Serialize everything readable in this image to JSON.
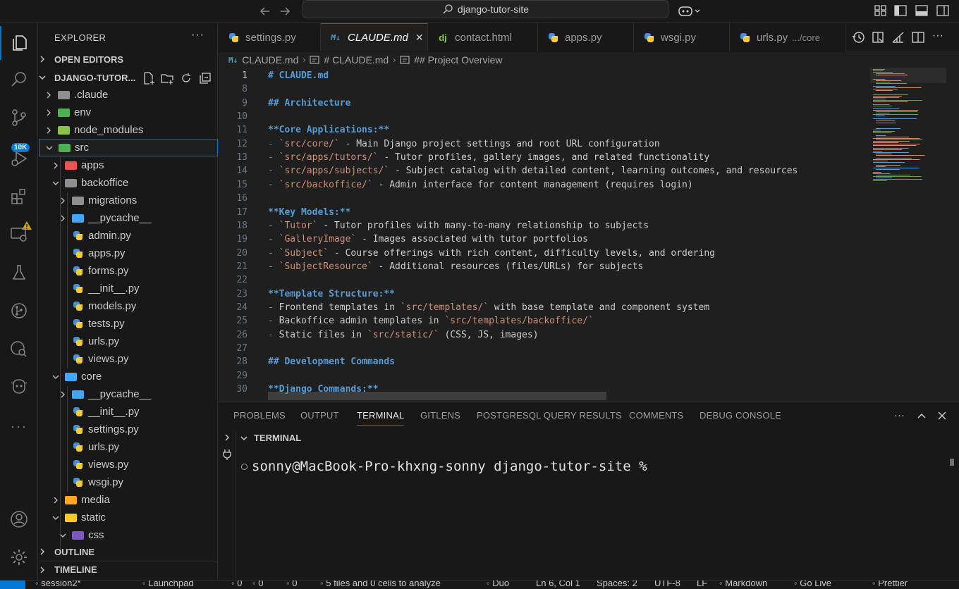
{
  "titlebar": {
    "search_text": "django-tutor-site",
    "back_icon": "arrow-left-icon",
    "forward_icon": "arrow-right-icon",
    "copilot_icon": "copilot-icon"
  },
  "activity": {
    "badge": "10K"
  },
  "sidebar": {
    "title": "EXPLORER",
    "more": "···",
    "open_editors": "OPEN EDITORS",
    "project": "DJANGO-TUTOR...",
    "outline": "OUTLINE",
    "timeline": "TIMELINE",
    "tree": [
      {
        "label": ".claude",
        "kind": "folder",
        "depth": 1,
        "open": false,
        "color": "#8f8f8f"
      },
      {
        "label": "env",
        "kind": "folder",
        "depth": 1,
        "open": false,
        "color": "#4caf50"
      },
      {
        "label": "node_modules",
        "kind": "folder",
        "depth": 1,
        "open": false,
        "color": "#8bc34a"
      },
      {
        "label": "src",
        "kind": "folder",
        "depth": 1,
        "open": true,
        "color": "#4caf50"
      },
      {
        "label": "apps",
        "kind": "folder",
        "depth": 2,
        "open": false,
        "color": "#ef5350"
      },
      {
        "label": "backoffice",
        "kind": "folder",
        "depth": 2,
        "open": true,
        "color": "#8f8f8f"
      },
      {
        "label": "migrations",
        "kind": "folder",
        "depth": 3,
        "open": false,
        "color": "#8f8f8f"
      },
      {
        "label": "__pycache__",
        "kind": "folder",
        "depth": 3,
        "open": false,
        "color": "#42a5f5"
      },
      {
        "label": "admin.py",
        "kind": "py",
        "depth": 3
      },
      {
        "label": "apps.py",
        "kind": "py",
        "depth": 3
      },
      {
        "label": "forms.py",
        "kind": "py",
        "depth": 3
      },
      {
        "label": "__init__.py",
        "kind": "py",
        "depth": 3
      },
      {
        "label": "models.py",
        "kind": "py",
        "depth": 3
      },
      {
        "label": "tests.py",
        "kind": "py",
        "depth": 3
      },
      {
        "label": "urls.py",
        "kind": "py",
        "depth": 3
      },
      {
        "label": "views.py",
        "kind": "py",
        "depth": 3
      },
      {
        "label": "core",
        "kind": "folder",
        "depth": 2,
        "open": true,
        "color": "#42a5f5"
      },
      {
        "label": "__pycache__",
        "kind": "folder",
        "depth": 3,
        "open": false,
        "color": "#42a5f5"
      },
      {
        "label": "__init__.py",
        "kind": "py",
        "depth": 3
      },
      {
        "label": "settings.py",
        "kind": "py",
        "depth": 3
      },
      {
        "label": "urls.py",
        "kind": "py",
        "depth": 3
      },
      {
        "label": "views.py",
        "kind": "py",
        "depth": 3
      },
      {
        "label": "wsgi.py",
        "kind": "py",
        "depth": 3
      },
      {
        "label": "media",
        "kind": "folder",
        "depth": 2,
        "open": false,
        "color": "#ffa726"
      },
      {
        "label": "static",
        "kind": "folder",
        "depth": 2,
        "open": true,
        "color": "#ffca28"
      },
      {
        "label": "css",
        "kind": "folder",
        "depth": 3,
        "open": true,
        "color": "#7e57c2"
      }
    ]
  },
  "tabs": [
    {
      "label": "settings.py",
      "icon": "python-icon",
      "active": false
    },
    {
      "label": "CLAUDE.md",
      "icon": "markdown-icon",
      "active": true
    },
    {
      "label": "contact.html",
      "icon": "django-icon",
      "active": false
    },
    {
      "label": "apps.py",
      "icon": "python-icon",
      "active": false
    },
    {
      "label": "wsgi.py",
      "icon": "python-icon",
      "active": false
    },
    {
      "label": "urls.py",
      "icon": "python-icon",
      "active": false,
      "desc": ".../core"
    }
  ],
  "breadcrumb": [
    "CLAUDE.md",
    "# CLAUDE.md",
    "## Project Overview"
  ],
  "editor": {
    "lines": [
      {
        "n": "1",
        "t": "# CLAUDE.md",
        "k": "h"
      },
      {
        "n": "8",
        "t": "",
        "k": "p"
      },
      {
        "n": "9",
        "t": "## Architecture",
        "k": "h"
      },
      {
        "n": "10",
        "t": "",
        "k": "p"
      },
      {
        "n": "11",
        "t": "**Core Applications:**",
        "k": "b"
      },
      {
        "n": "12",
        "t": "- `src/core/` - Main Django project settings and root URL configuration",
        "k": "li"
      },
      {
        "n": "13",
        "t": "- `src/apps/tutors/` - Tutor profiles, gallery images, and related functionality",
        "k": "li"
      },
      {
        "n": "14",
        "t": "- `src/apps/subjects/` - Subject catalog with detailed content, learning outcomes, and resources",
        "k": "li"
      },
      {
        "n": "15",
        "t": "- `src/backoffice/` - Admin interface for content management (requires login)",
        "k": "li"
      },
      {
        "n": "16",
        "t": "",
        "k": "p"
      },
      {
        "n": "17",
        "t": "**Key Models:**",
        "k": "b"
      },
      {
        "n": "18",
        "t": "- `Tutor` - Tutor profiles with many-to-many relationship to subjects",
        "k": "li"
      },
      {
        "n": "19",
        "t": "- `GalleryImage` - Images associated with tutor portfolios",
        "k": "li"
      },
      {
        "n": "20",
        "t": "- `Subject` - Course offerings with rich content, difficulty levels, and ordering",
        "k": "li"
      },
      {
        "n": "21",
        "t": "- `SubjectResource` - Additional resources (files/URLs) for subjects",
        "k": "li"
      },
      {
        "n": "22",
        "t": "",
        "k": "p"
      },
      {
        "n": "23",
        "t": "**Template Structure:**",
        "k": "b"
      },
      {
        "n": "24",
        "t": "- Frontend templates in `src/templates/` with base template and component system",
        "k": "li"
      },
      {
        "n": "25",
        "t": "- Backoffice admin templates in `src/templates/backoffice/`",
        "k": "li"
      },
      {
        "n": "26",
        "t": "- Static files in `src/static/` (CSS, JS, images)",
        "k": "li"
      },
      {
        "n": "27",
        "t": "",
        "k": "p"
      },
      {
        "n": "28",
        "t": "## Development Commands",
        "k": "h"
      },
      {
        "n": "29",
        "t": "",
        "k": "p"
      },
      {
        "n": "30",
        "t": "**Django Commands:**",
        "k": "b"
      }
    ]
  },
  "panel": {
    "tabs": [
      "PROBLEMS",
      "OUTPUT",
      "TERMINAL",
      "GITLENS",
      "POSTGRESQL QUERY RESULTS",
      "COMMENTS",
      "DEBUG CONSOLE"
    ],
    "active_tab": "TERMINAL",
    "more": "···",
    "terminal_header": "TERMINAL",
    "prompt": "sonny@MacBook-Pro-khxng-sonny django-tutor-site %"
  },
  "statusbar": {
    "items": [
      {
        "label": "session2*",
        "icon": "branch-icon"
      },
      {
        "label": "Launchpad",
        "icon": "rocket-icon"
      },
      {
        "label": "0",
        "icon": "error-icon"
      },
      {
        "label": "0",
        "icon": "warning-icon"
      },
      {
        "label": "0",
        "icon": "ports-icon"
      },
      {
        "label": "5 files and 0 cells to analyze",
        "icon": "sync-icon"
      },
      {
        "label": "Duo",
        "icon": "duo-icon"
      },
      {
        "label": "Ln 6, Col 1",
        "icon": ""
      },
      {
        "label": "Spaces: 2",
        "icon": ""
      },
      {
        "label": "UTF-8",
        "icon": ""
      },
      {
        "label": "LF",
        "icon": ""
      },
      {
        "label": "Markdown",
        "icon": "braces-icon"
      },
      {
        "label": "Go Live",
        "icon": "broadcast-icon"
      },
      {
        "label": "Prettier",
        "icon": "check-double-icon"
      }
    ]
  },
  "colors": {
    "accent": "#0078d4",
    "editor_bg": "#1f1f1f",
    "chrome_bg": "#181818"
  }
}
